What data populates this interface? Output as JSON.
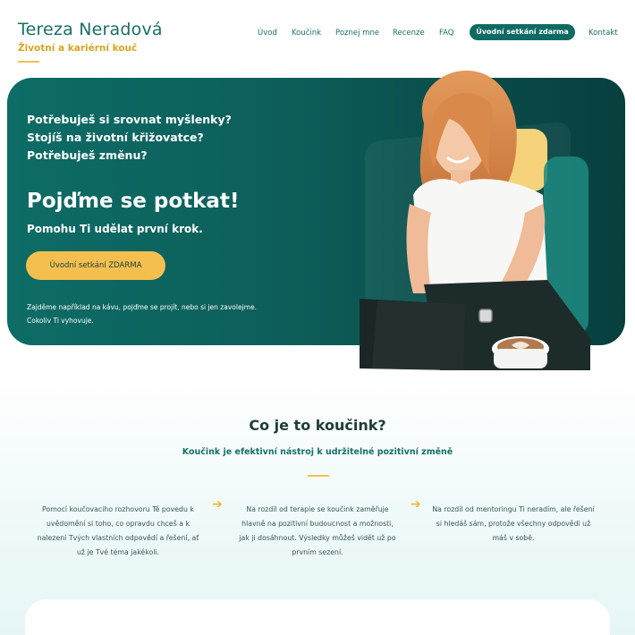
{
  "brand": {
    "name": "Tereza Neradová",
    "tagline": "Životní a kariérní kouč"
  },
  "nav": {
    "items": [
      "Úvod",
      "Koučink",
      "Poznej mne",
      "Recenze",
      "FAQ"
    ],
    "cta": "Úvodní setkání zdarma",
    "contact": "Kontakt"
  },
  "hero": {
    "questions": [
      "Potřebuješ si srovnat myšlenky?",
      "Stojíš na životní křižovatce?",
      "Potřebuješ změnu?"
    ],
    "title": "Pojďme se potkat!",
    "subtitle": "Pomohu Ti udělat první krok.",
    "button": "Úvodní setkání ZDARMA",
    "note_lines": [
      "Zajděme například na kávu, pojďme se projít, nebo si jen zavolejme.",
      "Cokoliv Ti vyhovuje."
    ]
  },
  "section": {
    "title": "Co je to koučink?",
    "subtitle": "Koučink je efektivní nástroj k udržitelné pozitivní změně",
    "columns": [
      [
        "Pomocí koučovacího rozhovoru Tě povedu k",
        "uvědomění si toho, co opravdu chceš a k",
        "nalezení Tvých vlastních odpovědí a řešení, ať",
        "už je Tvé téma jakékoli."
      ],
      [
        "Na rozdíl od terapie se koučink zaměřuje",
        "hlavně na pozitivní budoucnost a možnosti,",
        "jak ji dosáhnout. Výsledky můžeš vidět už po",
        "prvním sezení."
      ],
      [
        "Na rozdíl od mentoringu Ti neradím, ale řešení",
        "si hledáš sám, protože všechny odpovědi už",
        "máš v sobě."
      ]
    ]
  },
  "colors": {
    "primary": "#0e6b63",
    "accent": "#f5bf4f",
    "text_dark": "#1f3b3b"
  },
  "icons": [
    "arrow-right-icon"
  ]
}
